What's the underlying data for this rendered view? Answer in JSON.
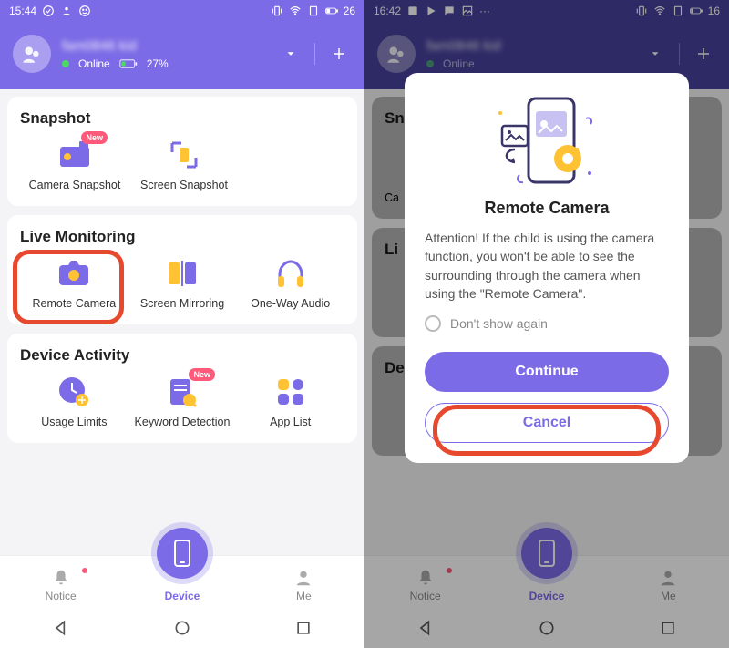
{
  "left": {
    "status": {
      "time": "15:44",
      "battery": "26"
    },
    "user": {
      "name": "fam0846 kid",
      "online": "Online",
      "battery": "27%"
    },
    "sections": {
      "snapshot": {
        "title": "Snapshot",
        "items": [
          {
            "label": "Camera Snapshot",
            "new": true
          },
          {
            "label": "Screen Snapshot",
            "new": false
          }
        ]
      },
      "live": {
        "title": "Live Monitoring",
        "items": [
          {
            "label": "Remote Camera"
          },
          {
            "label": "Screen Mirroring"
          },
          {
            "label": "One-Way Audio"
          }
        ]
      },
      "activity": {
        "title": "Device Activity",
        "items": [
          {
            "label": "Usage Limits",
            "new": false
          },
          {
            "label": "Keyword Detection",
            "new": true
          },
          {
            "label": "App List",
            "new": false
          }
        ]
      }
    },
    "nav": {
      "notice": "Notice",
      "device": "Device",
      "me": "Me"
    }
  },
  "right": {
    "status": {
      "time": "16:42",
      "battery": "16"
    },
    "modal": {
      "title": "Remote Camera",
      "body": "Attention! If the child is using the camera function, you won't be able to see the surrounding through the camera when using the \"Remote Camera\".",
      "dont_show": "Don't show again",
      "continue": "Continue",
      "cancel": "Cancel"
    }
  }
}
